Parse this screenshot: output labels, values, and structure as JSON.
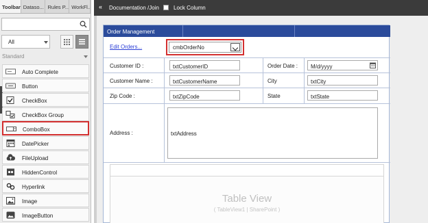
{
  "toolbox": {
    "tabs": [
      "Toolbar",
      "Dataso...",
      "Rules P...",
      "WorkFl..."
    ],
    "search_placeholder": "",
    "filter": "All",
    "section": "Standard",
    "items": [
      {
        "label": "Auto Complete",
        "icon": "autocomplete-icon"
      },
      {
        "label": "Button",
        "icon": "button-icon"
      },
      {
        "label": "CheckBox",
        "icon": "checkbox-icon"
      },
      {
        "label": "CheckBox Group",
        "icon": "checkbox-group-icon"
      },
      {
        "label": "ComboBox",
        "icon": "combobox-icon",
        "selected": true
      },
      {
        "label": "DatePicker",
        "icon": "datepicker-icon"
      },
      {
        "label": "FileUpload",
        "icon": "fileupload-icon"
      },
      {
        "label": "HiddenControl",
        "icon": "hiddencontrol-icon"
      },
      {
        "label": "Hyperlink",
        "icon": "hyperlink-icon"
      },
      {
        "label": "Image",
        "icon": "image-icon"
      },
      {
        "label": "ImageButton",
        "icon": "imagebutton-icon"
      }
    ]
  },
  "header": {
    "collapse": "«",
    "breadcrumb": "Documentation /Join",
    "lock_label": "Lock Column"
  },
  "form": {
    "title": "Order Management",
    "edit_link": "Edit Orders...",
    "combo_value": "cmbOrderNo",
    "fields": {
      "customer_id_label": "Customer ID :",
      "customer_id_value": "txtCustomerID",
      "order_date_label": "Order Date :",
      "order_date_value": "M/d/yyyy",
      "customer_name_label": "Customer Name :",
      "customer_name_value": "txtCustomerName",
      "city_label": "City",
      "city_value": "txtCity",
      "zip_label": "Zip Code :",
      "zip_value": "txtZipCode",
      "state_label": "State",
      "state_value": "txtState",
      "address_label": "Address :",
      "address_value": "txtAddress"
    },
    "table_view": {
      "title": "Table View",
      "subtitle": "( TableView1 | SharePoint )"
    }
  },
  "colors": {
    "header_blue": "#2b4b9b",
    "highlight_red": "#d32f2f",
    "link_blue": "#2a3ed6"
  }
}
